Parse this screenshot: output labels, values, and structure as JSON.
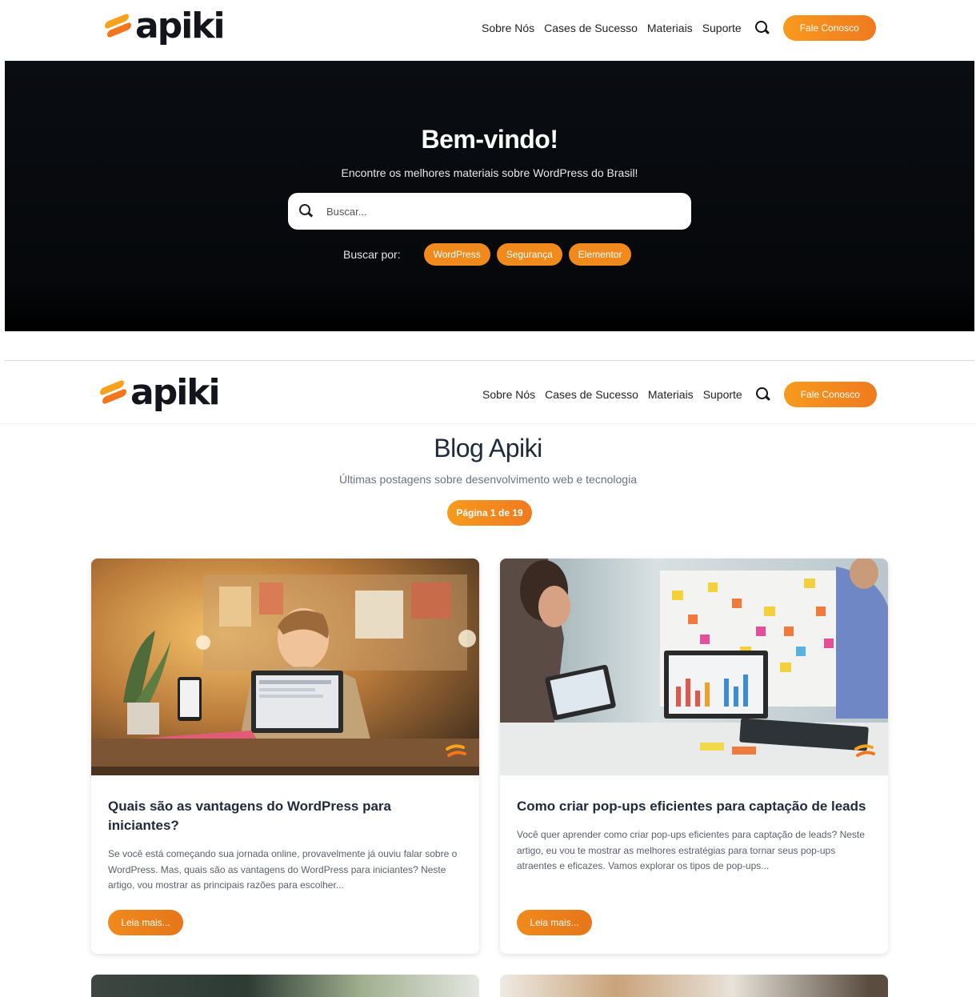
{
  "header": {
    "logo_text": "apiki",
    "nav": [
      "Sobre Nós",
      "Cases de Sucesso",
      "Materiais",
      "Suporte"
    ],
    "cta_label": "Fale Conosco",
    "icon": "search-icon"
  },
  "hero": {
    "title": "Bem-vindo!",
    "subtitle": "Encontre os melhores materiais sobre WordPress do Brasil!",
    "search_placeholder": "Buscar...",
    "tags_label": "Buscar por:",
    "tags": [
      "WordPress",
      "Segurança",
      "Elementor"
    ]
  },
  "blog": {
    "title": "Blog Apiki",
    "subtitle": "Últimas postagens sobre desenvolvimento web e tecnologia",
    "page_indicator": "Página 1 de 19",
    "posts": [
      {
        "title": "Quais são as vantagens do WordPress para iniciantes?",
        "excerpt": "Se você está começando sua jornada online, provavelmente já ouviu falar sobre o WordPress. Mas, quais são as vantagens do WordPress para iniciantes? Neste artigo, vou mostrar as principais razões para escolher...",
        "read_more": "Leia mais..."
      },
      {
        "title": "Como criar pop-ups eficientes para captação de leads",
        "excerpt": "Você quer aprender como criar pop-ups eficientes para captação de leads? Neste artigo, eu vou te mostrar as melhores estratégias para tornar seus pop-ups atraentes e eficazes. Vamos explorar os tipos de pop-ups...",
        "read_more": "Leia mais..."
      }
    ]
  },
  "colors": {
    "accent": "#f08a1c",
    "hero_bg": "#0a0d12",
    "heading": "#1f2a3a"
  }
}
